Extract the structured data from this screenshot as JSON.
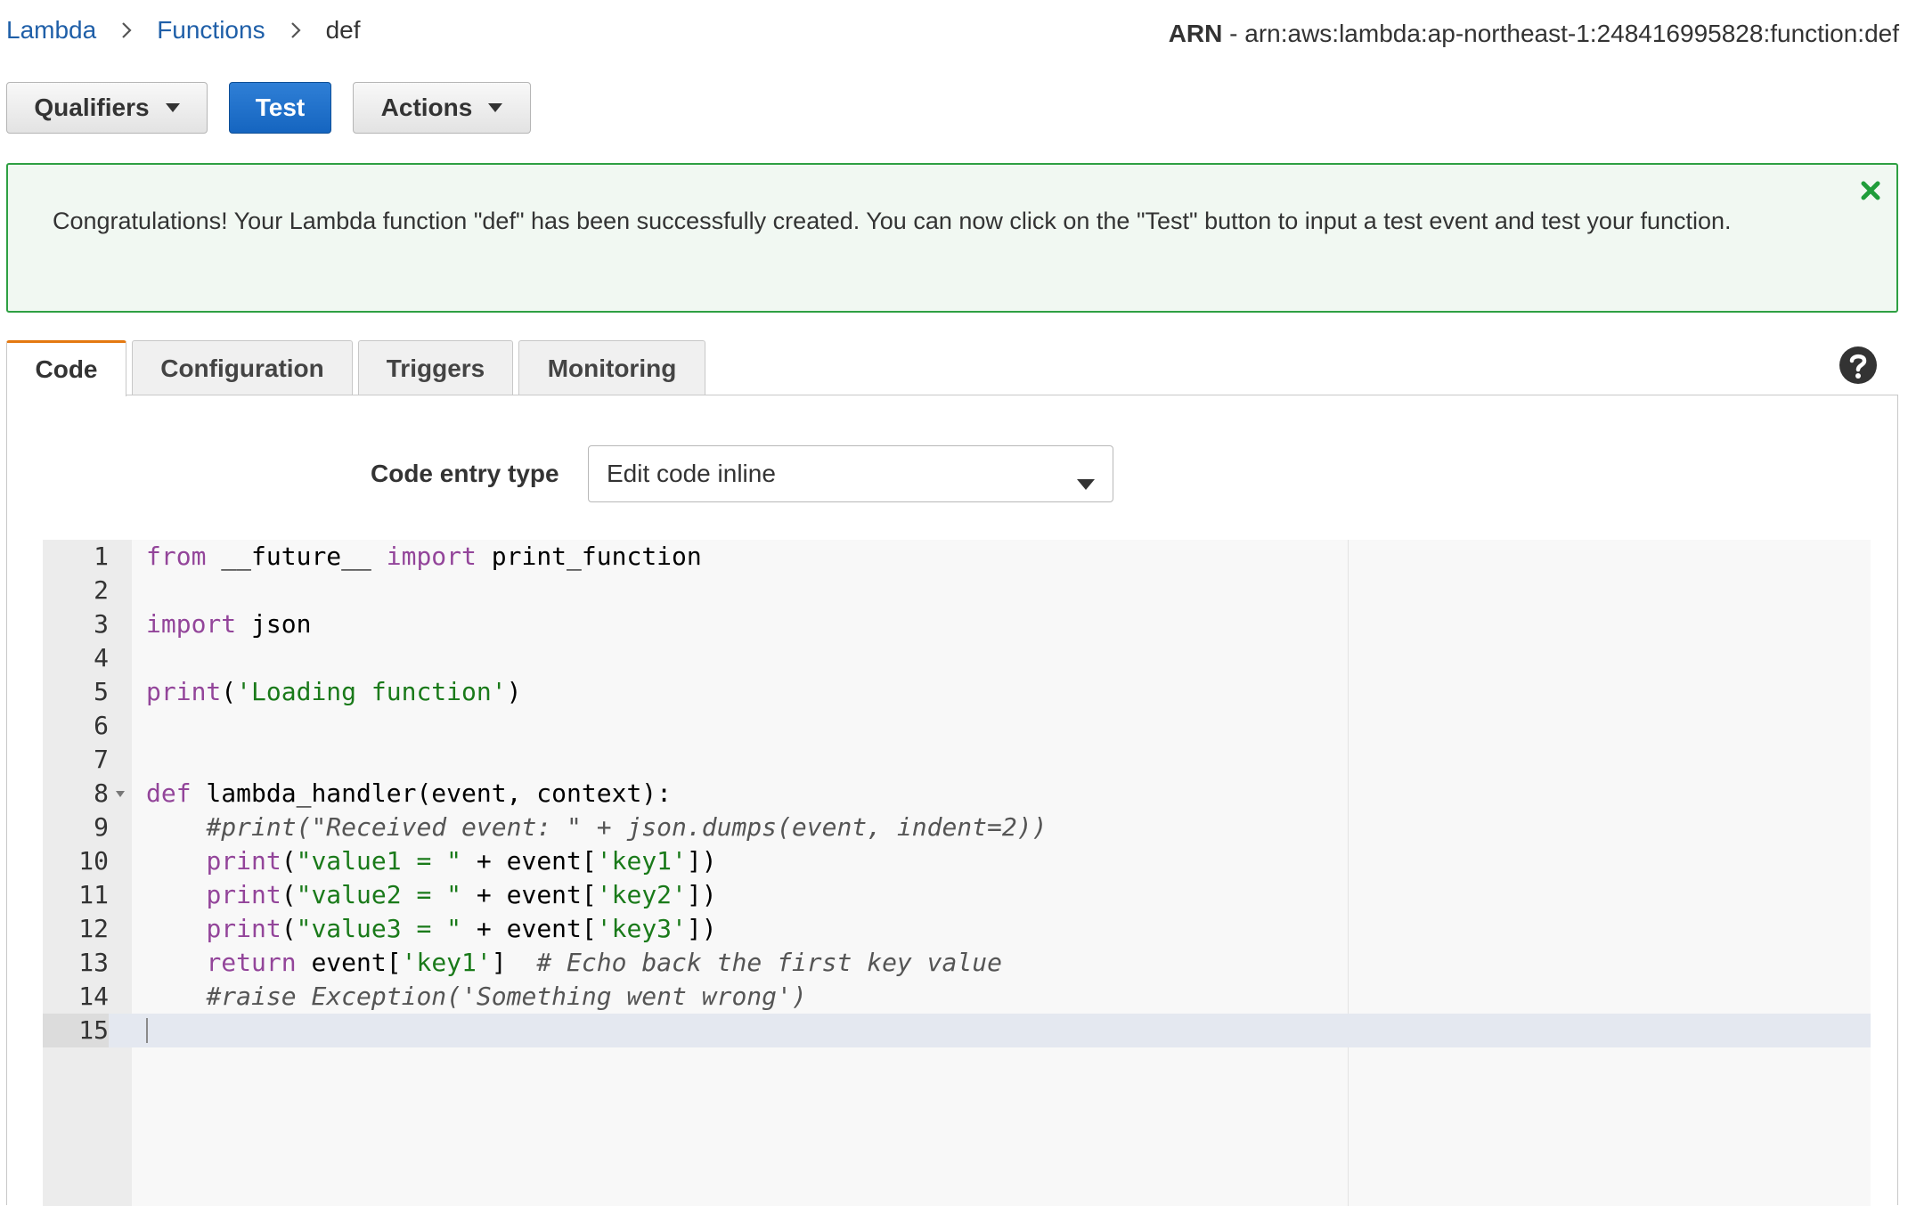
{
  "breadcrumb": {
    "root": "Lambda",
    "functions": "Functions",
    "current": "def"
  },
  "arn": {
    "label": "ARN",
    "separator": " - ",
    "value": "arn:aws:lambda:ap-northeast-1:248416995828:function:def"
  },
  "toolbar": {
    "qualifiers_label": "Qualifiers",
    "test_label": "Test",
    "actions_label": "Actions"
  },
  "alert": {
    "message": "Congratulations! Your Lambda function \"def\" has been successfully created. You can now click on the \"Test\" button to input a test event and test your function."
  },
  "tabs": {
    "code": "Code",
    "configuration": "Configuration",
    "triggers": "Triggers",
    "monitoring": "Monitoring"
  },
  "code_entry": {
    "label": "Code entry type",
    "value": "Edit code inline"
  },
  "editor": {
    "lines": [
      {
        "n": "1",
        "tokens": [
          {
            "c": "kw",
            "t": "from"
          },
          {
            "c": "",
            "t": " __future__ "
          },
          {
            "c": "kw",
            "t": "import"
          },
          {
            "c": "",
            "t": " print_function"
          }
        ]
      },
      {
        "n": "2",
        "tokens": []
      },
      {
        "n": "3",
        "tokens": [
          {
            "c": "kw",
            "t": "import"
          },
          {
            "c": "",
            "t": " json"
          }
        ]
      },
      {
        "n": "4",
        "tokens": []
      },
      {
        "n": "5",
        "tokens": [
          {
            "c": "kw",
            "t": "print"
          },
          {
            "c": "",
            "t": "("
          },
          {
            "c": "str",
            "t": "'Loading function'"
          },
          {
            "c": "",
            "t": ")"
          }
        ]
      },
      {
        "n": "6",
        "tokens": []
      },
      {
        "n": "7",
        "tokens": []
      },
      {
        "n": "8",
        "tokens": [
          {
            "c": "kw",
            "t": "def"
          },
          {
            "c": "",
            "t": " lambda_handler(event, context):"
          }
        ]
      },
      {
        "n": "9",
        "tokens": [
          {
            "c": "",
            "t": "    "
          },
          {
            "c": "cmt",
            "t": "#print(\"Received event: \" + json.dumps(event, indent=2))"
          }
        ]
      },
      {
        "n": "10",
        "tokens": [
          {
            "c": "",
            "t": "    "
          },
          {
            "c": "kw",
            "t": "print"
          },
          {
            "c": "",
            "t": "("
          },
          {
            "c": "str",
            "t": "\"value1 = \""
          },
          {
            "c": "",
            "t": " + event["
          },
          {
            "c": "str",
            "t": "'key1'"
          },
          {
            "c": "",
            "t": "])"
          }
        ]
      },
      {
        "n": "11",
        "tokens": [
          {
            "c": "",
            "t": "    "
          },
          {
            "c": "kw",
            "t": "print"
          },
          {
            "c": "",
            "t": "("
          },
          {
            "c": "str",
            "t": "\"value2 = \""
          },
          {
            "c": "",
            "t": " + event["
          },
          {
            "c": "str",
            "t": "'key2'"
          },
          {
            "c": "",
            "t": "])"
          }
        ]
      },
      {
        "n": "12",
        "tokens": [
          {
            "c": "",
            "t": "    "
          },
          {
            "c": "kw",
            "t": "print"
          },
          {
            "c": "",
            "t": "("
          },
          {
            "c": "str",
            "t": "\"value3 = \""
          },
          {
            "c": "",
            "t": " + event["
          },
          {
            "c": "str",
            "t": "'key3'"
          },
          {
            "c": "",
            "t": "])"
          }
        ]
      },
      {
        "n": "13",
        "tokens": [
          {
            "c": "",
            "t": "    "
          },
          {
            "c": "kw",
            "t": "return"
          },
          {
            "c": "",
            "t": " event["
          },
          {
            "c": "str",
            "t": "'key1'"
          },
          {
            "c": "",
            "t": "]  "
          },
          {
            "c": "cmt",
            "t": "# Echo back the first key value"
          }
        ]
      },
      {
        "n": "14",
        "tokens": [
          {
            "c": "",
            "t": "    "
          },
          {
            "c": "cmt",
            "t": "#raise Exception('Something went wrong')"
          }
        ]
      },
      {
        "n": "15",
        "tokens": []
      }
    ],
    "active_line": 15,
    "fold_line": 8
  },
  "colors": {
    "link": "#1f5fa8",
    "primary_button": "#1565c0",
    "success_border": "#2ea043",
    "active_tab_accent": "#e47911"
  }
}
